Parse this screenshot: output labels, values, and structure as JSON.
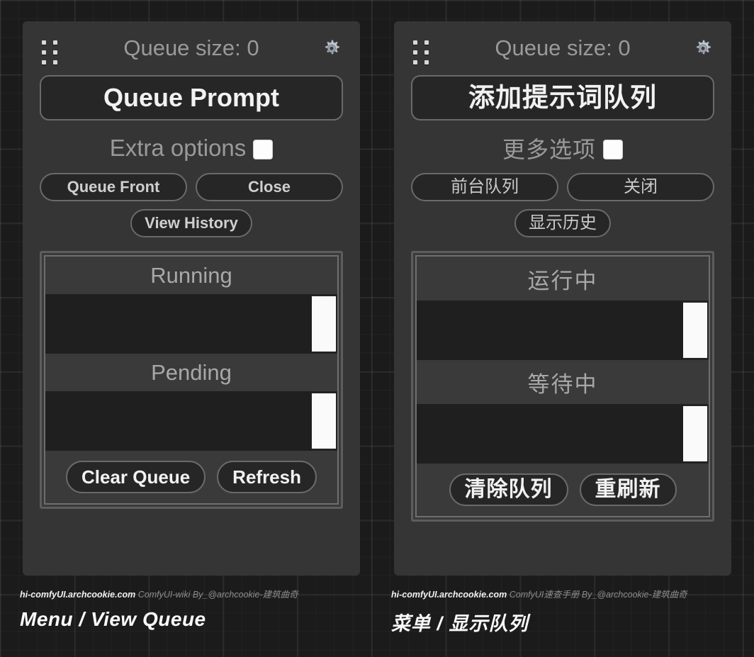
{
  "panels": [
    {
      "lang": "en",
      "header": {
        "drag_handle": "drag-handle",
        "queue_size_label": "Queue size: 0",
        "gear": "gear-icon"
      },
      "queue_prompt_label": "Queue Prompt",
      "extra_options_label": "Extra options",
      "extra_options_checked": false,
      "buttons": {
        "queue_front": "Queue Front",
        "close": "Close",
        "view_history": "View History"
      },
      "queue": {
        "running_label": "Running",
        "pending_label": "Pending",
        "running_items": [],
        "pending_items": [],
        "clear_queue_label": "Clear Queue",
        "refresh_label": "Refresh"
      },
      "caption": {
        "credit_site": "hi-comfyUI.archcookie.com",
        "credit_rest": "ComfyUI-wiki  By_@archcookie-建筑曲奇",
        "title": "Menu / View Queue"
      }
    },
    {
      "lang": "zh",
      "header": {
        "drag_handle": "drag-handle",
        "queue_size_label": "Queue size: 0",
        "gear": "gear-icon"
      },
      "queue_prompt_label": "添加提示词队列",
      "extra_options_label": "更多选项",
      "extra_options_checked": false,
      "buttons": {
        "queue_front": "前台队列",
        "close": "关闭",
        "view_history": "显示历史"
      },
      "queue": {
        "running_label": "运行中",
        "pending_label": "等待中",
        "running_items": [],
        "pending_items": [],
        "clear_queue_label": "清除队列",
        "refresh_label": "重刷新"
      },
      "caption": {
        "credit_site": "hi-comfyUI.archcookie.com",
        "credit_rest": "ComfyUI速查手册  By_@archcookie-建筑曲奇",
        "title": "菜单 / 显示队列"
      }
    }
  ],
  "colors": {
    "background": "#1b1b1b",
    "panel": "#353535",
    "button_face": "#262626",
    "button_border": "#6a6a6a",
    "text_primary": "#f2f2f2",
    "text_muted": "#9a9a9a",
    "list_background": "#1f1f1f",
    "scrollbar_thumb": "#fafafa"
  }
}
